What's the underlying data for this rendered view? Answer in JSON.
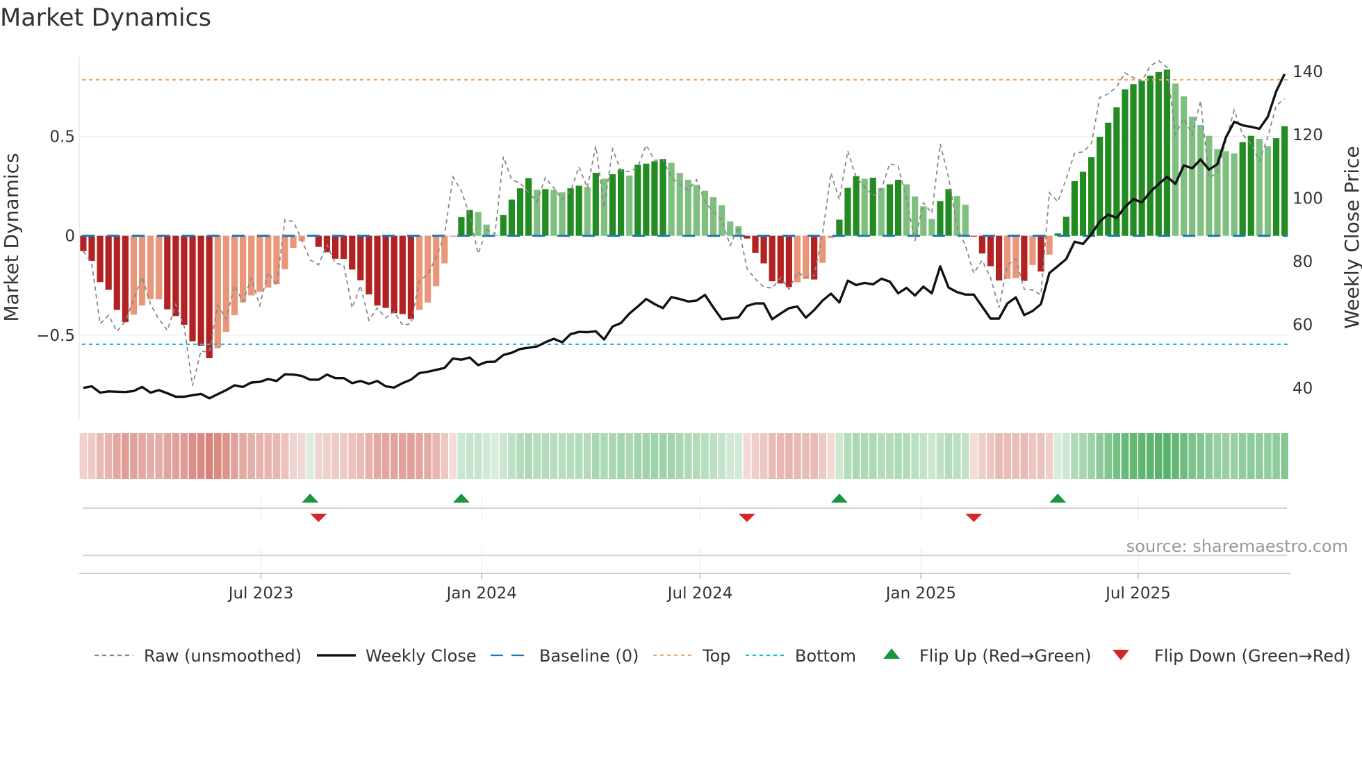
{
  "title": "Market Dynamics",
  "source": "source: sharemaestro.com",
  "legend": [
    {
      "key": "raw",
      "label": "Raw (unsmoothed)",
      "color": "#888888",
      "style": "dashed"
    },
    {
      "key": "close",
      "label": "Weekly Close",
      "color": "#111111",
      "style": "solid"
    },
    {
      "key": "baseline",
      "label": "Baseline (0)",
      "color": "#1f77b4",
      "style": "long-dash"
    },
    {
      "key": "top",
      "label": "Top",
      "color": "#f4a460",
      "style": "dotted"
    },
    {
      "key": "bottom",
      "label": "Bottom",
      "color": "#17becf",
      "style": "dotted"
    },
    {
      "key": "flip_up",
      "label": "Flip Up (Red→Green)",
      "color": "#1a9641",
      "style": "triangle-up"
    },
    {
      "key": "flip_down",
      "label": "Flip Down (Green→Red)",
      "color": "#d62728",
      "style": "triangle-down"
    }
  ],
  "chart_data": {
    "type": "bar",
    "title": "Market Dynamics",
    "ylabel": "Market Dynamics",
    "y2label": "Weekly Close Price",
    "ylim": [
      -0.92,
      0.9
    ],
    "y2lim": [
      30.3,
      144.6
    ],
    "yticks": [
      {
        "v": 0.5,
        "label": "0.5"
      },
      {
        "v": 0,
        "label": "0"
      },
      {
        "v": -0.5,
        "label": "−0.5"
      }
    ],
    "y2ticks": [
      {
        "v": 140,
        "label": "140"
      },
      {
        "v": 120,
        "label": "120"
      },
      {
        "v": 100,
        "label": "100"
      },
      {
        "v": 80,
        "label": "80"
      },
      {
        "v": 60,
        "label": "60"
      },
      {
        "v": 40,
        "label": "40"
      }
    ],
    "xticks": [
      {
        "date": "2023-07-01",
        "label": "Jul 2023"
      },
      {
        "date": "2024-01-01",
        "label": "Jan 2024"
      },
      {
        "date": "2024-07-01",
        "label": "Jul 2024"
      },
      {
        "date": "2025-01-01",
        "label": "Jan 2025"
      },
      {
        "date": "2025-07-01",
        "label": "Jul 2025"
      }
    ],
    "grid": "horizontal",
    "legend_position": "bottom",
    "top_level": 0.785,
    "bottom_level": -0.546,
    "baseline": 0,
    "colors": {
      "red_dark": "#b22222",
      "red_light": "#e9967a",
      "green_dark": "#228b22",
      "green_light": "#7fbf7f",
      "strip_red": "#c0392b",
      "strip_green": "#2e9e44"
    },
    "dates": [
      "2023-02-03",
      "2023-02-10",
      "2023-02-17",
      "2023-02-24",
      "2023-03-03",
      "2023-03-10",
      "2023-03-17",
      "2023-03-24",
      "2023-03-31",
      "2023-04-07",
      "2023-04-14",
      "2023-04-21",
      "2023-04-28",
      "2023-05-05",
      "2023-05-12",
      "2023-05-19",
      "2023-05-26",
      "2023-06-02",
      "2023-06-09",
      "2023-06-16",
      "2023-06-23",
      "2023-06-30",
      "2023-07-07",
      "2023-07-14",
      "2023-07-21",
      "2023-07-28",
      "2023-08-04",
      "2023-08-11",
      "2023-08-18",
      "2023-08-25",
      "2023-09-01",
      "2023-09-08",
      "2023-09-15",
      "2023-09-22",
      "2023-09-29",
      "2023-10-06",
      "2023-10-13",
      "2023-10-20",
      "2023-10-27",
      "2023-11-03",
      "2023-11-10",
      "2023-11-17",
      "2023-11-24",
      "2023-12-01",
      "2023-12-08",
      "2023-12-15",
      "2023-12-22",
      "2023-12-29",
      "2024-01-05",
      "2024-01-12",
      "2024-01-19",
      "2024-01-26",
      "2024-02-02",
      "2024-02-09",
      "2024-02-16",
      "2024-02-23",
      "2024-03-01",
      "2024-03-08",
      "2024-03-15",
      "2024-03-22",
      "2024-03-29",
      "2024-04-05",
      "2024-04-12",
      "2024-04-19",
      "2024-04-26",
      "2024-05-03",
      "2024-05-10",
      "2024-05-17",
      "2024-05-24",
      "2024-05-31",
      "2024-06-07",
      "2024-06-14",
      "2024-06-21",
      "2024-06-28",
      "2024-07-05",
      "2024-07-12",
      "2024-07-19",
      "2024-07-26",
      "2024-08-02",
      "2024-08-09",
      "2024-08-16",
      "2024-08-23",
      "2024-08-30",
      "2024-09-06",
      "2024-09-13",
      "2024-09-20",
      "2024-09-27",
      "2024-10-04",
      "2024-10-11",
      "2024-10-18",
      "2024-10-25",
      "2024-11-01",
      "2024-11-08",
      "2024-11-15",
      "2024-11-22",
      "2024-11-29",
      "2024-12-06",
      "2024-12-13",
      "2024-12-20",
      "2024-12-27",
      "2025-01-03",
      "2025-01-10",
      "2025-01-17",
      "2025-01-24",
      "2025-01-31",
      "2025-02-07",
      "2025-02-14",
      "2025-02-21",
      "2025-02-28",
      "2025-03-07",
      "2025-03-14",
      "2025-03-21",
      "2025-03-28",
      "2025-04-04",
      "2025-04-11",
      "2025-04-18",
      "2025-04-25",
      "2025-05-02",
      "2025-05-09",
      "2025-05-16",
      "2025-05-23",
      "2025-05-30",
      "2025-06-06",
      "2025-06-13",
      "2025-06-20",
      "2025-06-27",
      "2025-07-04",
      "2025-07-11",
      "2025-07-18",
      "2025-07-25",
      "2025-08-01",
      "2025-08-08",
      "2025-08-15",
      "2025-08-22",
      "2025-08-29",
      "2025-09-05",
      "2025-09-12",
      "2025-09-19",
      "2025-09-26",
      "2025-10-03",
      "2025-10-10",
      "2025-10-17",
      "2025-10-24",
      "2025-10-31"
    ],
    "smoothed": [
      -0.077,
      -0.127,
      -0.233,
      -0.272,
      -0.373,
      -0.435,
      -0.397,
      -0.351,
      -0.32,
      -0.32,
      -0.37,
      -0.404,
      -0.448,
      -0.531,
      -0.553,
      -0.616,
      -0.566,
      -0.484,
      -0.4,
      -0.335,
      -0.3,
      -0.282,
      -0.261,
      -0.243,
      -0.168,
      -0.061,
      -0.027,
      0.003,
      -0.056,
      -0.083,
      -0.116,
      -0.117,
      -0.17,
      -0.224,
      -0.295,
      -0.351,
      -0.363,
      -0.39,
      -0.394,
      -0.419,
      -0.373,
      -0.336,
      -0.254,
      -0.139,
      -0.005,
      0.094,
      0.13,
      0.12,
      0.056,
      0.005,
      0.104,
      0.182,
      0.239,
      0.29,
      0.231,
      0.235,
      0.231,
      0.219,
      0.239,
      0.252,
      0.245,
      0.317,
      0.287,
      0.31,
      0.335,
      0.303,
      0.357,
      0.363,
      0.375,
      0.386,
      0.367,
      0.316,
      0.282,
      0.256,
      0.227,
      0.194,
      0.154,
      0.072,
      0.048,
      -0.014,
      -0.086,
      -0.139,
      -0.229,
      -0.24,
      -0.258,
      -0.234,
      -0.217,
      -0.22,
      -0.136,
      -0.012,
      0.081,
      0.241,
      0.3,
      0.287,
      0.292,
      0.24,
      0.259,
      0.282,
      0.259,
      0.198,
      0.148,
      0.085,
      0.174,
      0.235,
      0.2,
      0.157,
      -0.004,
      -0.089,
      -0.153,
      -0.225,
      -0.217,
      -0.213,
      -0.227,
      -0.147,
      -0.18,
      -0.095,
      0.012,
      0.096,
      0.275,
      0.322,
      0.396,
      0.498,
      0.569,
      0.647,
      0.737,
      0.763,
      0.78,
      0.806,
      0.824,
      0.836,
      0.766,
      0.702,
      0.6,
      0.558,
      0.503,
      0.436,
      0.425,
      0.414,
      0.471,
      0.503,
      0.488,
      0.451,
      0.491,
      0.551
    ],
    "raw": [
      -0.077,
      -0.139,
      -0.443,
      -0.4,
      -0.481,
      -0.431,
      -0.32,
      -0.208,
      -0.345,
      -0.42,
      -0.476,
      -0.345,
      -0.456,
      -0.755,
      -0.58,
      -0.585,
      -0.349,
      -0.418,
      -0.251,
      -0.332,
      -0.214,
      -0.351,
      -0.183,
      -0.251,
      0.081,
      0.072,
      -0.021,
      -0.121,
      -0.146,
      -0.046,
      -0.139,
      -0.146,
      -0.363,
      -0.251,
      -0.425,
      -0.363,
      -0.413,
      -0.381,
      -0.45,
      -0.443,
      -0.226,
      -0.195,
      -0.109,
      0.004,
      0.296,
      0.227,
      0.1,
      -0.09,
      0.03,
      0.01,
      0.398,
      0.282,
      0.265,
      0.218,
      0.172,
      0.293,
      0.241,
      0.183,
      0.224,
      0.346,
      0.241,
      0.452,
      0.143,
      0.436,
      0.328,
      0.322,
      0.346,
      0.456,
      0.38,
      0.383,
      0.293,
      0.259,
      0.23,
      0.282,
      0.172,
      0.119,
      0.079,
      -0.049,
      0.044,
      -0.165,
      -0.217,
      -0.258,
      -0.263,
      -0.211,
      -0.269,
      -0.182,
      -0.211,
      -0.2,
      0.009,
      0.316,
      0.183,
      0.427,
      0.293,
      0.247,
      0.2,
      0.235,
      0.363,
      0.351,
      0.183,
      -0.026,
      0.166,
      0.114,
      0.462,
      0.293,
      0.044,
      -0.049,
      -0.188,
      -0.124,
      -0.211,
      -0.362,
      -0.147,
      -0.118,
      -0.269,
      -0.273,
      -0.297,
      0.217,
      0.171,
      0.287,
      0.416,
      0.422,
      0.463,
      0.696,
      0.714,
      0.749,
      0.819,
      0.796,
      0.778,
      0.854,
      0.881,
      0.848,
      0.509,
      0.591,
      0.509,
      0.679,
      0.293,
      0.317,
      0.48,
      0.632,
      0.509,
      0.463,
      0.375,
      0.498,
      0.655,
      0.69
    ],
    "close": [
      40.0,
      40.5,
      38.5,
      38.9,
      38.8,
      38.7,
      39.0,
      40.3,
      38.5,
      39.3,
      38.3,
      37.2,
      37.2,
      37.7,
      38.1,
      36.7,
      38.0,
      39.3,
      40.8,
      40.3,
      41.7,
      41.9,
      42.8,
      42.2,
      44.3,
      44.2,
      43.8,
      42.6,
      42.6,
      44.2,
      43.1,
      43.1,
      41.5,
      42.2,
      41.3,
      42.2,
      40.5,
      40.1,
      41.5,
      42.6,
      44.7,
      45.1,
      45.7,
      46.3,
      49.3,
      48.9,
      49.6,
      47.2,
      48.2,
      48.3,
      50.4,
      51.1,
      52.3,
      52.7,
      53.1,
      54.4,
      55.5,
      54.4,
      57.0,
      57.7,
      57.6,
      57.9,
      55.3,
      59.4,
      60.5,
      63.5,
      65.7,
      68.1,
      66.5,
      65.2,
      68.7,
      68.1,
      67.3,
      67.6,
      69.4,
      65.4,
      61.7,
      62.0,
      62.3,
      65.9,
      66.7,
      66.7,
      61.7,
      63.5,
      65.2,
      65.7,
      62.2,
      64.6,
      67.6,
      69.8,
      67.0,
      73.9,
      72.5,
      73.2,
      72.7,
      74.5,
      73.6,
      69.9,
      71.6,
      69.2,
      72.0,
      69.9,
      78.4,
      71.7,
      70.3,
      69.5,
      69.5,
      65.7,
      61.9,
      61.9,
      66.7,
      68.6,
      63.0,
      64.3,
      66.5,
      76.3,
      78.5,
      80.7,
      86.2,
      85.5,
      88.6,
      92.6,
      94.8,
      93.7,
      97.2,
      99.7,
      98.6,
      101.9,
      104.4,
      106.7,
      104.5,
      110.3,
      109.4,
      112.2,
      109.0,
      110.7,
      119.1,
      124.1,
      123.0,
      122.5,
      121.9,
      125.7,
      133.7,
      139.2
    ],
    "flip_up": [
      "2023-08-11",
      "2023-12-15",
      "2024-10-25",
      "2025-04-25"
    ],
    "flip_down": [
      "2023-08-18",
      "2024-08-09",
      "2025-02-14"
    ]
  }
}
